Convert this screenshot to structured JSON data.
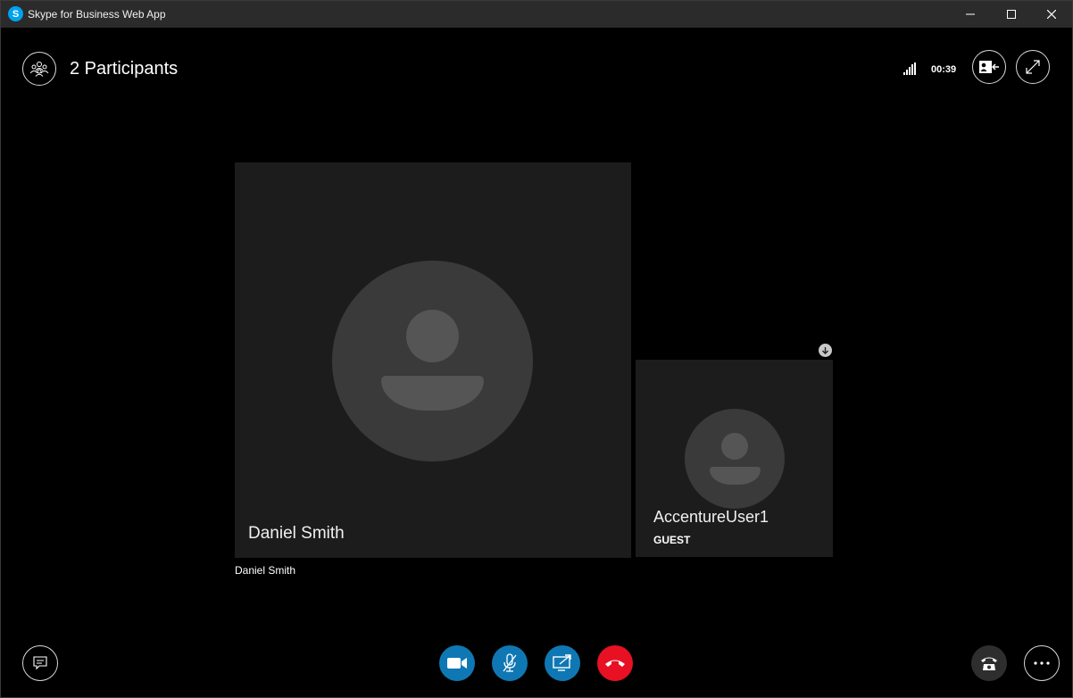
{
  "window": {
    "title": "Skype for Business Web App",
    "app_icon_letter": "S"
  },
  "header": {
    "participants_label": "2 Participants",
    "call_duration": "00:39"
  },
  "tiles": [
    {
      "name": "Daniel Smith",
      "role": ""
    },
    {
      "name": "AccentureUser1",
      "role": "GUEST"
    }
  ],
  "active_speaker_caption": "Daniel Smith",
  "icons": {
    "participants": "people-group-icon",
    "signal": "signal-strength-icon",
    "contact_card": "contact-card-icon",
    "fullscreen": "expand-icon",
    "chat": "chat-bubble-icon",
    "video": "video-camera-icon",
    "mic": "microphone-muted-icon",
    "share": "share-screen-icon",
    "hangup": "hang-up-icon",
    "dialpad": "phone-dialpad-icon",
    "more": "more-options-icon"
  },
  "colors": {
    "background": "#000000",
    "titlebar": "#2b2b2b",
    "tile": "#1c1c1c",
    "accent_blue": "#0f78b4",
    "hangup_red": "#e81123"
  }
}
